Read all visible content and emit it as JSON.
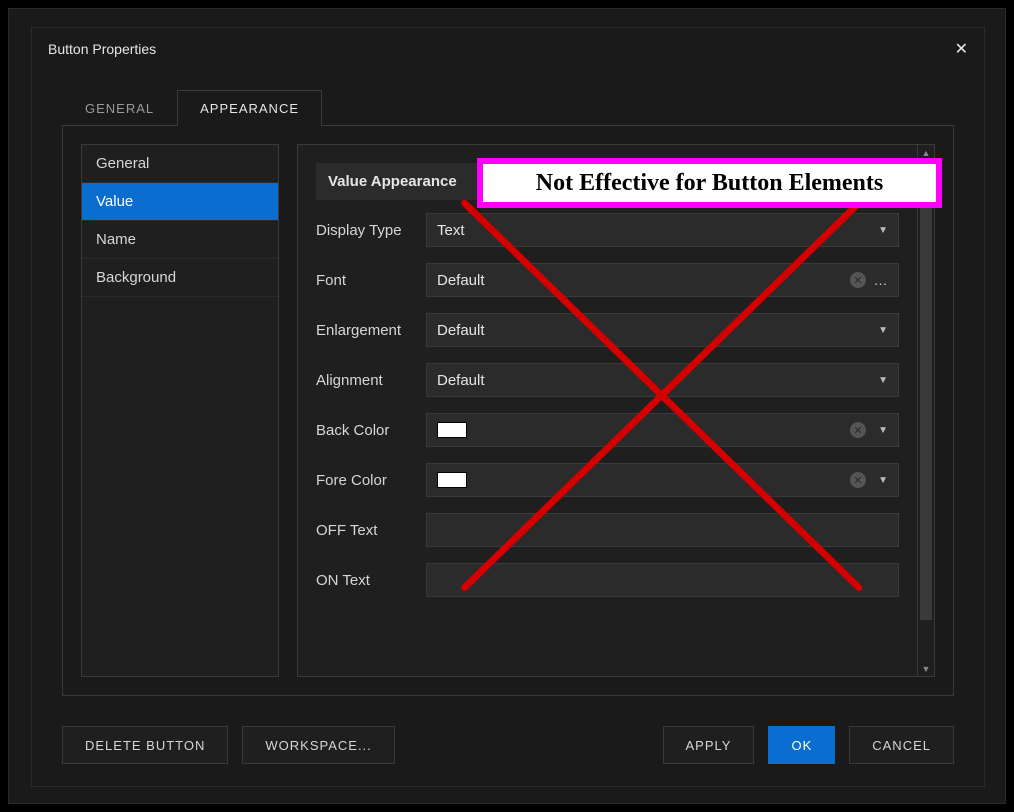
{
  "dialog": {
    "title": "Button Properties"
  },
  "tabs": {
    "general": "GENERAL",
    "appearance": "APPEARANCE"
  },
  "sidebar": {
    "items": [
      {
        "label": "General"
      },
      {
        "label": "Value"
      },
      {
        "label": "Name"
      },
      {
        "label": "Background"
      }
    ]
  },
  "panel": {
    "title": "Value Appearance",
    "rows": {
      "display_type": {
        "label": "Display Type",
        "value": "Text"
      },
      "font": {
        "label": "Font",
        "value": "Default"
      },
      "enlargement": {
        "label": "Enlargement",
        "value": "Default"
      },
      "alignment": {
        "label": "Alignment",
        "value": "Default"
      },
      "back_color": {
        "label": "Back Color"
      },
      "fore_color": {
        "label": "Fore Color"
      },
      "off_text": {
        "label": "OFF Text",
        "value": ""
      },
      "on_text": {
        "label": "ON Text",
        "value": ""
      }
    }
  },
  "annotation": {
    "text": "Not Effective for Button Elements"
  },
  "footer": {
    "delete": "DELETE BUTTON",
    "workspace": "WORKSPACE...",
    "apply": "APPLY",
    "ok": "OK",
    "cancel": "CANCEL"
  }
}
